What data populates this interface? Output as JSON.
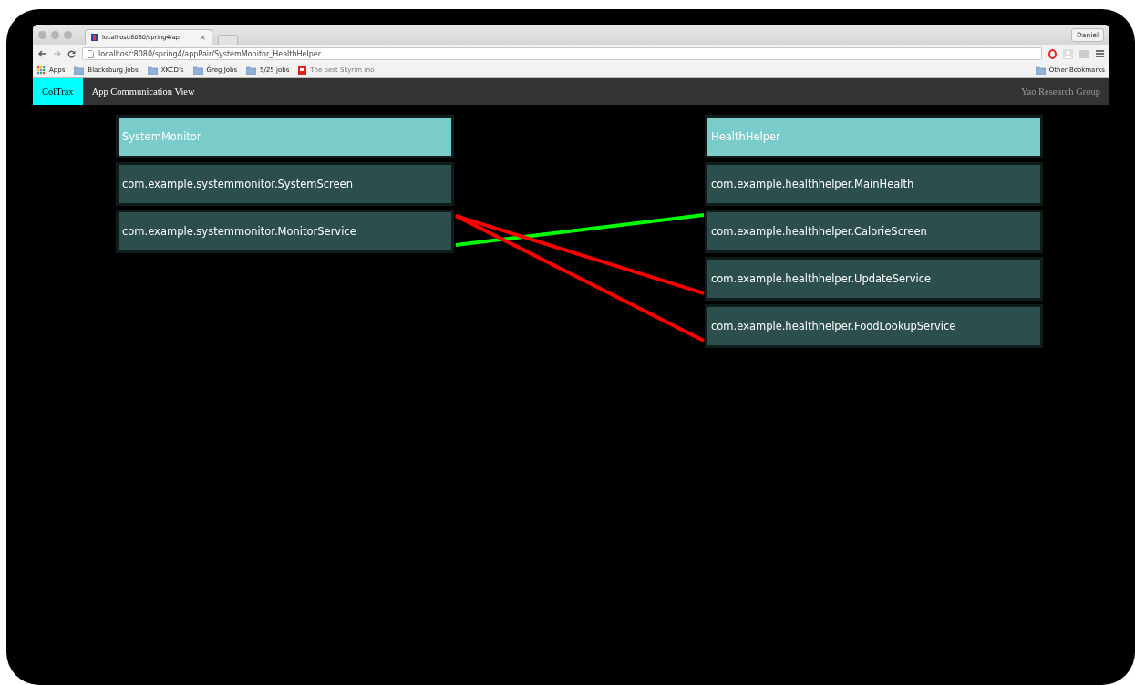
{
  "browser": {
    "tab": {
      "title": "localhost:8080/spring4/ap",
      "close": "×"
    },
    "profile": "Daniel",
    "url": "localhost:8080/spring4/appPair/SystemMonitor_HealthHelper",
    "bookmarks": [
      {
        "label": "Apps",
        "kind": "apps"
      },
      {
        "label": "Blacksburg Jobs",
        "kind": "folder"
      },
      {
        "label": "XKCD's",
        "kind": "folder"
      },
      {
        "label": "Greg Jobs",
        "kind": "folder"
      },
      {
        "label": "5/25 jobs",
        "kind": "folder"
      },
      {
        "label": "The best Skyrim mo",
        "kind": "page"
      }
    ],
    "other_bookmarks": "Other Bookmarks"
  },
  "navbar": {
    "brand": "ColTrax",
    "title": "App Communication View",
    "right": "Yao Research Group"
  },
  "apps": [
    {
      "name": "SystemMonitor",
      "components": [
        {
          "name": "com.example.systemmonitor.SystemScreen"
        },
        {
          "name": "com.example.systemmonitor.MonitorService",
          "linked": true
        }
      ]
    },
    {
      "name": "HealthHelper",
      "components": [
        {
          "name": "com.example.healthhelper.MainHealth"
        },
        {
          "name": "com.example.healthhelper.CalorieScreen",
          "links": [
            {
              "kind": "in",
              "color": "#00ff00"
            }
          ]
        },
        {
          "name": "com.example.healthhelper.UpdateService",
          "links": [
            {
              "kind": "out",
              "color": "#ff0000"
            }
          ]
        },
        {
          "name": "com.example.healthhelper.FoodLookupService",
          "links": [
            {
              "kind": "out",
              "color": "#ff0000"
            }
          ]
        }
      ]
    }
  ]
}
